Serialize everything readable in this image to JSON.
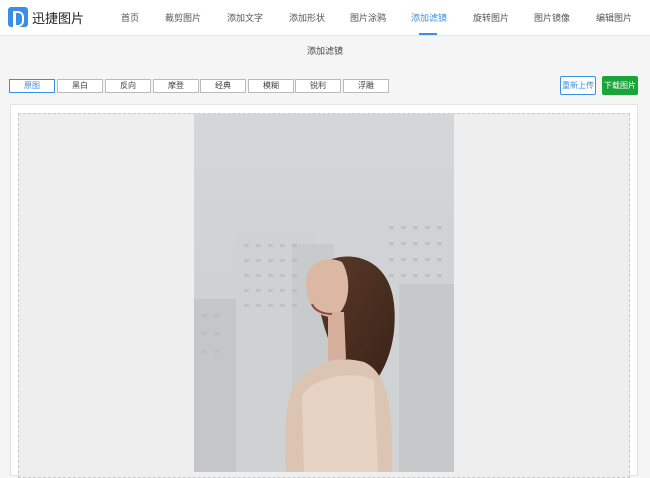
{
  "app": {
    "title": "迅捷图片"
  },
  "nav": {
    "items": [
      "首页",
      "裁剪图片",
      "添加文字",
      "添加形状",
      "图片涂鸦",
      "添加滤镜",
      "旋转图片",
      "图片镜像",
      "编辑图片"
    ],
    "active_index": 5
  },
  "page": {
    "title": "添加滤镜"
  },
  "filters": {
    "items": [
      "原图",
      "黑白",
      "反向",
      "摩登",
      "经典",
      "模糊",
      "锐利",
      "浮雕"
    ],
    "selected_index": 0
  },
  "actions": {
    "reupload_label": "重新上传",
    "download_label": "下载图片"
  },
  "colors": {
    "accent": "#3a8ee6",
    "download": "#1aa53b"
  },
  "image": {
    "icon": "photo-icon"
  }
}
